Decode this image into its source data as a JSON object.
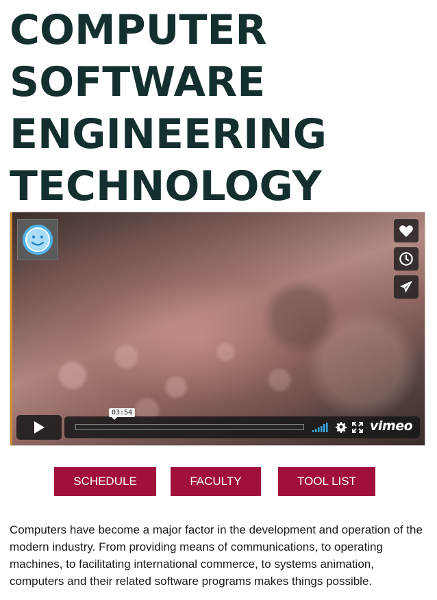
{
  "page": {
    "title_lines": [
      "COMPUTER",
      "SOFTWARE",
      "ENGINEERING",
      "TECHNOLOGY"
    ]
  },
  "video": {
    "time_display": "03:54",
    "brand": "vimeo",
    "side_buttons": [
      {
        "icon": "heart-icon",
        "label": "like"
      },
      {
        "icon": "clock-icon",
        "label": "watch-later"
      },
      {
        "icon": "paper-plane-icon",
        "label": "share"
      }
    ],
    "progress": 0,
    "accent_color": "#d08b2a"
  },
  "nav_buttons": {
    "schedule": "SCHEDULE",
    "faculty": "FACULTY",
    "tool_list": "TOOL LIST"
  },
  "colors": {
    "title": "#13302f",
    "button_bg": "#a0103b",
    "button_text": "#ffffff",
    "body_text": "#1a1a1a"
  },
  "description": "Computers have become a major factor in the development and operation of the modern industry. From providing means of communications, to operating machines, to facilitating international commerce, to systems animation, computers and their related software programs makes things possible."
}
